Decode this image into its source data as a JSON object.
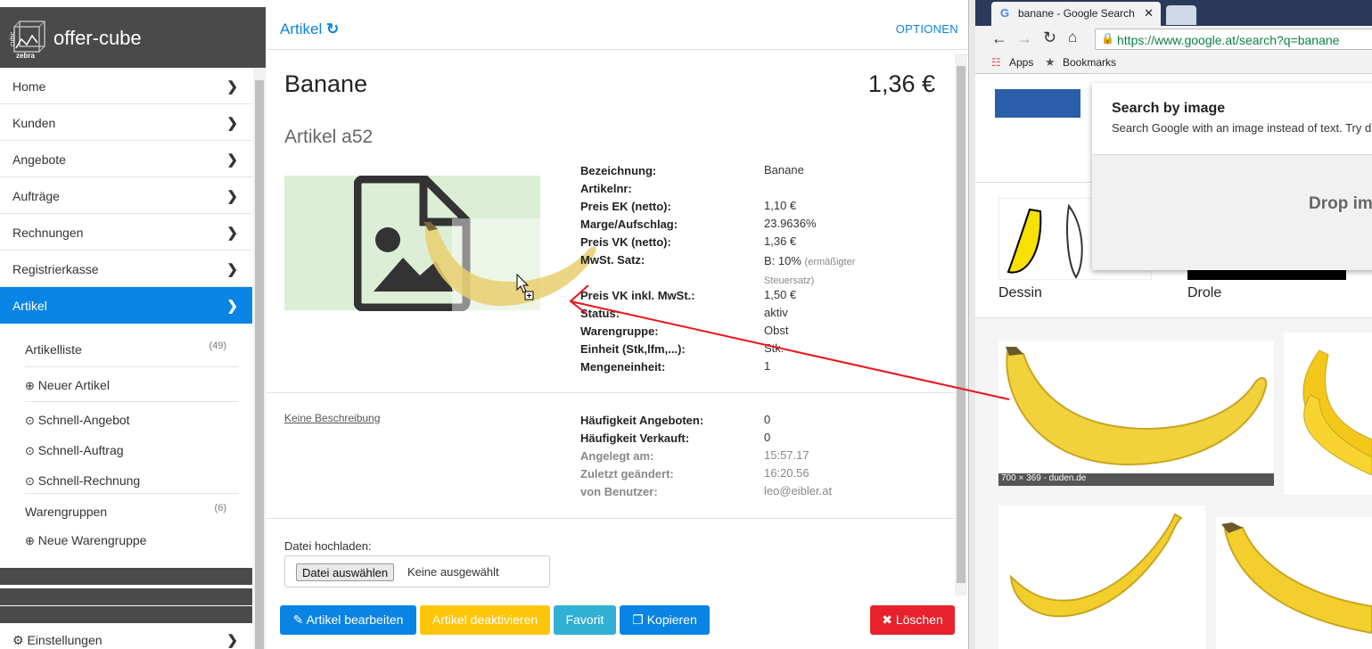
{
  "app": {
    "brand": {
      "logo_top": "cubic",
      "logo_bottom": "zebra",
      "title": "offer-cube"
    },
    "nav": [
      {
        "label": "Home"
      },
      {
        "label": "Kunden"
      },
      {
        "label": "Angebote"
      },
      {
        "label": "Aufträge"
      },
      {
        "label": "Rechnungen"
      },
      {
        "label": "Registrierkasse"
      },
      {
        "label": "Artikel"
      }
    ],
    "subnav": {
      "artikelliste": {
        "label": "Artikelliste",
        "count": "(49)"
      },
      "neuer_artikel": {
        "label": "Neuer Artikel"
      },
      "schnell_angebot": {
        "label": "Schnell-Angebot"
      },
      "schnell_auftrag": {
        "label": "Schnell-Auftrag"
      },
      "schnell_rechnung": {
        "label": "Schnell-Rechnung"
      },
      "warengruppen": {
        "label": "Warengruppen",
        "count": "(6)"
      },
      "neue_warengruppe": {
        "label": "Neue Warengruppe"
      }
    },
    "settings_label": "Einstellungen",
    "header": {
      "crumb": "Artikel",
      "options": "OPTIONEN"
    },
    "article": {
      "name": "Banane",
      "price": "1,36 €",
      "subtitle": "Artikel a52",
      "details": [
        {
          "label": "Bezeichnung:",
          "value": "Banane"
        },
        {
          "label": "Artikelnr:",
          "value": ""
        },
        {
          "label": "Preis EK (netto):",
          "value": "1,10 €"
        },
        {
          "label": "Marge/Aufschlag:",
          "value": "23.9636%"
        },
        {
          "label": "Preis VK (netto):",
          "value": "1,36 €"
        },
        {
          "label": "MwSt. Satz:",
          "value": "B: 10%",
          "note": "(ermäßigter Steuersatz)"
        },
        {
          "label": "Preis VK inkl. MwSt.:",
          "value": "1,50 €"
        },
        {
          "label": "Status:",
          "value": "aktiv"
        },
        {
          "label": "Warengruppe:",
          "value": "Obst"
        },
        {
          "label": "Einheit (Stk,lfm,...):",
          "value": "Stk."
        },
        {
          "label": "Mengeneinheit:",
          "value": "1"
        }
      ],
      "description_link": "Keine Beschreibung",
      "stats": [
        {
          "label": "Häufigkeit Angeboten:",
          "value": "0"
        },
        {
          "label": "Häufigkeit Verkauft:",
          "value": "0"
        },
        {
          "label": "Angelegt am:",
          "value": "15:57.17"
        },
        {
          "label": "Zuletzt geändert:",
          "value": "16:20.56"
        },
        {
          "label": "von Benutzer:",
          "value": "leo@eibler.at"
        }
      ],
      "upload_label": "Datei hochladen:",
      "upload_button": "Datei auswählen",
      "upload_status": "Keine ausgewählt"
    },
    "buttons": {
      "edit": "Artikel bearbeiten",
      "deactivate": "Artikel deaktivieren",
      "favorite": "Favorit",
      "copy": "Kopieren",
      "delete": "Löschen"
    },
    "colors": {
      "primary": "#0a84e4",
      "warning": "#fdc608",
      "info": "#31b0d5",
      "danger": "#e8222a",
      "dark": "#4a4a4a"
    }
  },
  "browser": {
    "tab_title": "banane - Google Search",
    "url": "https://www.google.at/search?q=banane",
    "bookmarks": [
      "Apps",
      "Bookmarks"
    ],
    "popup_title": "Search by image",
    "popup_text": "Search Google with an image instead of text. Try d",
    "drop_text": "Drop im",
    "thumb_labels": [
      "Dessin",
      "Drole"
    ],
    "image_caption": "700 × 369 - duden.de"
  }
}
